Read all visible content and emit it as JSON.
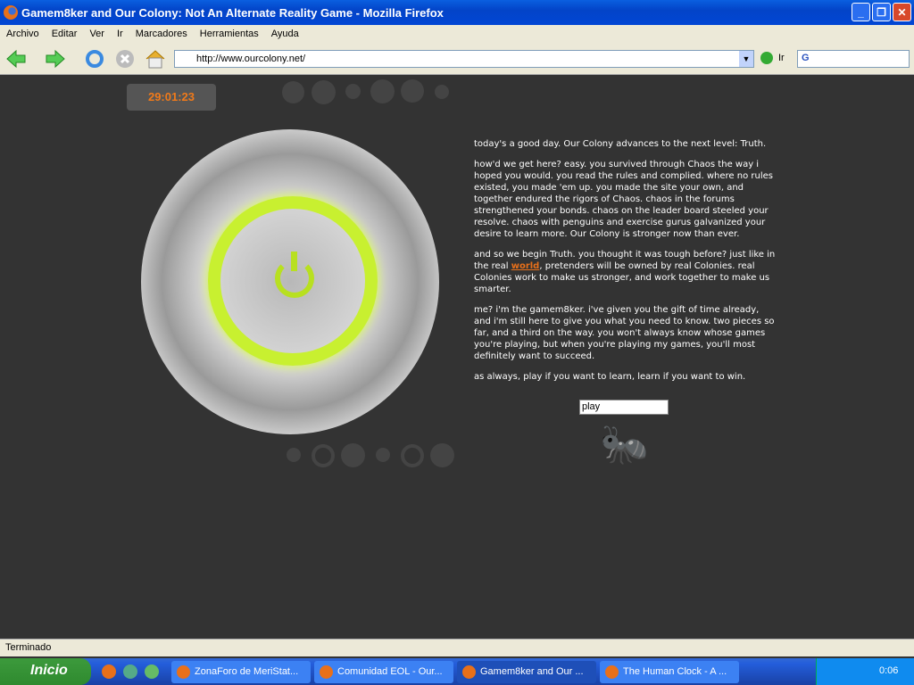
{
  "window": {
    "title": "Gamem8ker and Our Colony: Not An Alternate Reality Game - Mozilla Firefox"
  },
  "menu": [
    "Archivo",
    "Editar",
    "Ver",
    "Ir",
    "Marcadores",
    "Herramientas",
    "Ayuda"
  ],
  "toolbar": {
    "url": "http://www.ourcolony.net/",
    "go_label": "Ir",
    "search_logo": "G"
  },
  "page": {
    "timer": "29:01:23",
    "p1": "today's a good day. Our Colony advances to the next level: Truth.",
    "p2": "how'd we get here? easy. you survived through Chaos the way i hoped you would. you read the rules and complied. where no rules existed, you made 'em up. you made the site your own, and together endured the rigors of Chaos. chaos in the forums strengthened your bonds. chaos on the leader board steeled your resolve. chaos with penguins and exercise gurus galvanized your desire to learn more. Our Colony is stronger now than ever.",
    "p3a": "and so we begin Truth. you thought it was tough before? just like in the real ",
    "p3link": "world",
    "p3b": ", pretenders will be owned by real Colonies. real Colonies work to make us stronger, and work together to make us smarter.",
    "p4": "me? i'm the gamem8ker. i've given you the gift of time already, and i'm still here to give you what you need to know. two pieces so far, and a third on the way. you won't always know whose games you're playing, but when you're playing my games, you'll most definitely want to succeed.",
    "p5": "as always, play if you want to learn, learn if you want to win.",
    "input_value": "play"
  },
  "status": "Terminado",
  "taskbar": {
    "start": "Inicio",
    "tasks": [
      "ZonaForo de MeriStat...",
      "Comunidad EOL - Our...",
      "Gamem8ker and Our ...",
      "The Human Clock - A ..."
    ],
    "clock": "0:06"
  }
}
